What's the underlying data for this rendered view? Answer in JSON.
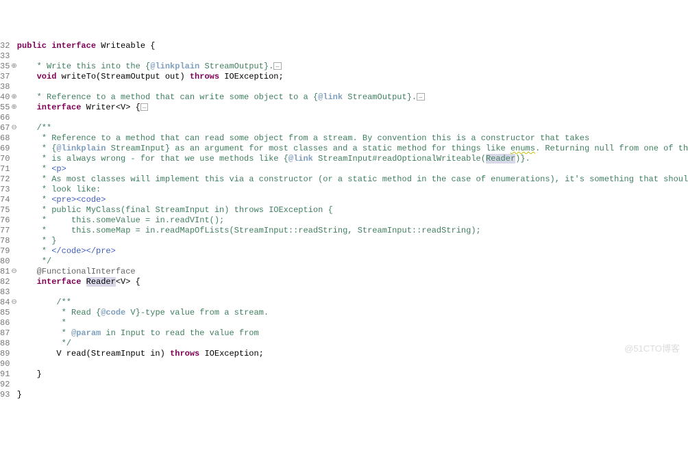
{
  "lines": [
    {
      "num": "32",
      "fold": "",
      "tokens": [
        {
          "t": "public ",
          "c": "kw"
        },
        {
          "t": "interface ",
          "c": "kw"
        },
        {
          "t": "Writeable {"
        }
      ]
    },
    {
      "num": "33",
      "fold": "",
      "tokens": []
    },
    {
      "num": "35",
      "fold": "⊕",
      "tokens": [
        {
          "t": "    "
        },
        {
          "t": "* Write this into the {",
          "c": "comment"
        },
        {
          "t": "@linkplain",
          "c": "doctag"
        },
        {
          "t": " StreamOutput}.",
          "c": "comment"
        },
        {
          "t": "…",
          "c": "fold-box"
        }
      ]
    },
    {
      "num": "37",
      "fold": "",
      "tokens": [
        {
          "t": "    "
        },
        {
          "t": "void ",
          "c": "kw"
        },
        {
          "t": "writeTo(StreamOutput out) "
        },
        {
          "t": "throws ",
          "c": "kw"
        },
        {
          "t": "IOException;"
        }
      ]
    },
    {
      "num": "38",
      "fold": "",
      "tokens": []
    },
    {
      "num": "40",
      "fold": "⊕",
      "tokens": [
        {
          "t": "    "
        },
        {
          "t": "* Reference to a method that can write some object to a {",
          "c": "comment"
        },
        {
          "t": "@link",
          "c": "doctag"
        },
        {
          "t": " StreamOutput}.",
          "c": "comment"
        },
        {
          "t": "…",
          "c": "fold-box"
        }
      ]
    },
    {
      "num": "55",
      "fold": "⊕",
      "tokens": [
        {
          "t": "    "
        },
        {
          "t": "interface ",
          "c": "kw"
        },
        {
          "t": "Writer<V> {"
        },
        {
          "t": "…",
          "c": "fold-box"
        }
      ]
    },
    {
      "num": "66",
      "fold": "",
      "tokens": []
    },
    {
      "num": "67",
      "fold": "⊖",
      "tokens": [
        {
          "t": "    "
        },
        {
          "t": "/**",
          "c": "comment"
        }
      ]
    },
    {
      "num": "68",
      "fold": "",
      "tokens": [
        {
          "t": "     "
        },
        {
          "t": "* Reference to a method that can read some object from a stream. By convention this is a constructor that takes",
          "c": "comment"
        }
      ]
    },
    {
      "num": "69",
      "fold": "",
      "tokens": [
        {
          "t": "     "
        },
        {
          "t": "* {",
          "c": "comment"
        },
        {
          "t": "@linkplain",
          "c": "doctag"
        },
        {
          "t": " StreamInput} as an argument for most classes and a static method for things like ",
          "c": "comment"
        },
        {
          "t": "enums",
          "c": "comment squiggle"
        },
        {
          "t": ". Returning null from one of these",
          "c": "comment"
        }
      ]
    },
    {
      "num": "70",
      "fold": "",
      "tokens": [
        {
          "t": "     "
        },
        {
          "t": "* is always wrong - for that we use methods like {",
          "c": "comment"
        },
        {
          "t": "@link",
          "c": "doctag"
        },
        {
          "t": " StreamInput#readOptionalWriteable(",
          "c": "comment"
        },
        {
          "t": "Reader",
          "c": "comment highlight"
        },
        {
          "t": ")}.",
          "c": "comment"
        }
      ]
    },
    {
      "num": "71",
      "fold": "",
      "tokens": [
        {
          "t": "     "
        },
        {
          "t": "* ",
          "c": "comment"
        },
        {
          "t": "<p>",
          "c": "doclink"
        }
      ]
    },
    {
      "num": "72",
      "fold": "",
      "tokens": [
        {
          "t": "     "
        },
        {
          "t": "* As most classes will implement this via a constructor (or a static method in the case of enumerations), it's something that should",
          "c": "comment"
        }
      ]
    },
    {
      "num": "73",
      "fold": "",
      "tokens": [
        {
          "t": "     "
        },
        {
          "t": "* look like:",
          "c": "comment"
        }
      ]
    },
    {
      "num": "74",
      "fold": "",
      "tokens": [
        {
          "t": "     "
        },
        {
          "t": "* ",
          "c": "comment"
        },
        {
          "t": "<pre><code>",
          "c": "doclink"
        }
      ]
    },
    {
      "num": "75",
      "fold": "",
      "tokens": [
        {
          "t": "     "
        },
        {
          "t": "* public MyClass(final StreamInput in) throws IOException {",
          "c": "comment"
        }
      ]
    },
    {
      "num": "76",
      "fold": "",
      "tokens": [
        {
          "t": "     "
        },
        {
          "t": "*     this.someValue = in.readVInt();",
          "c": "comment"
        }
      ]
    },
    {
      "num": "77",
      "fold": "",
      "tokens": [
        {
          "t": "     "
        },
        {
          "t": "*     this.someMap = in.readMapOfLists(StreamInput::readString, StreamInput::readString);",
          "c": "comment"
        }
      ]
    },
    {
      "num": "78",
      "fold": "",
      "tokens": [
        {
          "t": "     "
        },
        {
          "t": "* }",
          "c": "comment"
        }
      ]
    },
    {
      "num": "79",
      "fold": "",
      "tokens": [
        {
          "t": "     "
        },
        {
          "t": "* ",
          "c": "comment"
        },
        {
          "t": "</code></pre>",
          "c": "doclink"
        }
      ]
    },
    {
      "num": "80",
      "fold": "",
      "tokens": [
        {
          "t": "     "
        },
        {
          "t": "*/",
          "c": "comment"
        }
      ]
    },
    {
      "num": "81",
      "fold": "⊖",
      "tokens": [
        {
          "t": "    "
        },
        {
          "t": "@FunctionalInterface",
          "c": "annotation"
        }
      ]
    },
    {
      "num": "82",
      "fold": "",
      "tokens": [
        {
          "t": "    "
        },
        {
          "t": "interface ",
          "c": "kw"
        },
        {
          "t": "Reader",
          "c": "highlight"
        },
        {
          "t": "<V> {"
        }
      ]
    },
    {
      "num": "83",
      "fold": "",
      "tokens": []
    },
    {
      "num": "84",
      "fold": "⊖",
      "tokens": [
        {
          "t": "        "
        },
        {
          "t": "/**",
          "c": "comment"
        }
      ]
    },
    {
      "num": "85",
      "fold": "",
      "tokens": [
        {
          "t": "         "
        },
        {
          "t": "* Read {",
          "c": "comment"
        },
        {
          "t": "@code",
          "c": "doctag"
        },
        {
          "t": " V}-type value from a stream.",
          "c": "comment"
        }
      ]
    },
    {
      "num": "86",
      "fold": "",
      "tokens": [
        {
          "t": "         "
        },
        {
          "t": "*",
          "c": "comment"
        }
      ]
    },
    {
      "num": "87",
      "fold": "",
      "tokens": [
        {
          "t": "         "
        },
        {
          "t": "* ",
          "c": "comment"
        },
        {
          "t": "@param",
          "c": "doctag"
        },
        {
          "t": " in Input to read the value from",
          "c": "comment"
        }
      ]
    },
    {
      "num": "88",
      "fold": "",
      "tokens": [
        {
          "t": "         "
        },
        {
          "t": "*/",
          "c": "comment"
        }
      ]
    },
    {
      "num": "89",
      "fold": "",
      "tokens": [
        {
          "t": "        V read(StreamInput in) "
        },
        {
          "t": "throws ",
          "c": "kw"
        },
        {
          "t": "IOException;"
        }
      ]
    },
    {
      "num": "90",
      "fold": "",
      "tokens": []
    },
    {
      "num": "91",
      "fold": "",
      "tokens": [
        {
          "t": "    }"
        }
      ]
    },
    {
      "num": "92",
      "fold": "",
      "tokens": []
    },
    {
      "num": "93",
      "fold": "",
      "tokens": [
        {
          "t": "}"
        }
      ]
    }
  ],
  "watermark": "@51CTO博客"
}
